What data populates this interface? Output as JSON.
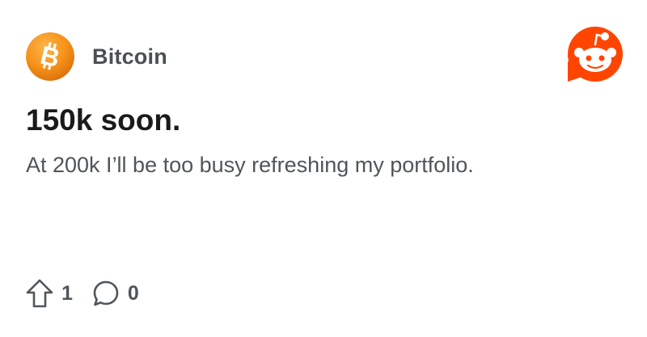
{
  "post": {
    "community": {
      "name": "Bitcoin",
      "avatar_icon": "bitcoin-logo-icon",
      "avatar_color": "#f7931a"
    },
    "brand": {
      "icon": "reddit-logo-icon",
      "color": "#ff4500"
    },
    "title": "150k soon.",
    "body": "At 200k I’ll be too busy refreshing my portfolio.",
    "actions": {
      "upvote": {
        "icon": "upvote-arrow-icon",
        "count": "1"
      },
      "comments": {
        "icon": "comment-bubble-icon",
        "count": "0"
      }
    }
  }
}
